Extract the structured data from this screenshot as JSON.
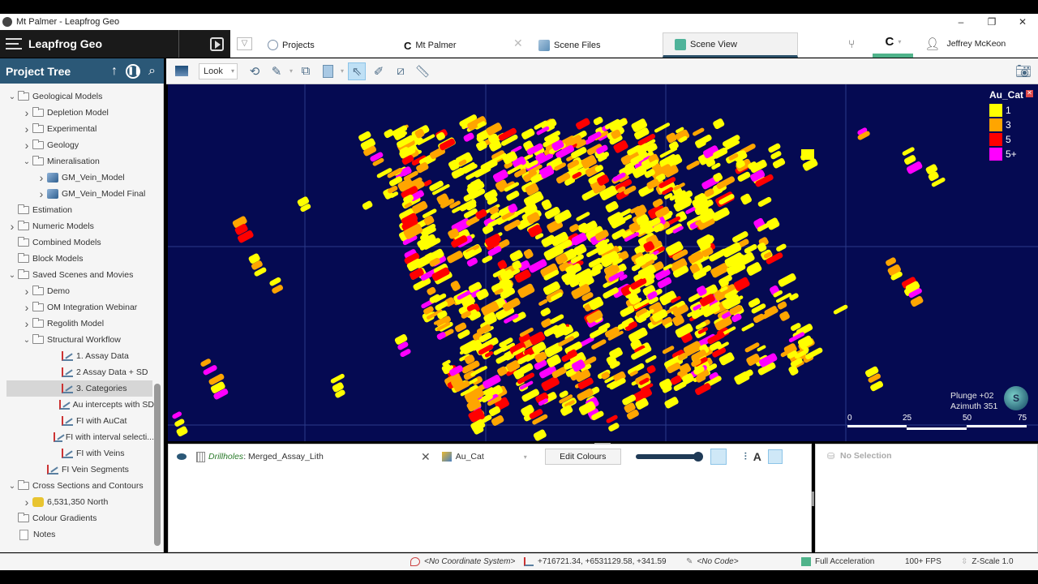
{
  "window": {
    "title": "Mt Palmer - Leapfrog Geo",
    "controls": [
      "–",
      "❐",
      "✕"
    ]
  },
  "appbar": {
    "brand": "Leapfrog Geo",
    "tabs": [
      {
        "label": "Projects",
        "icon": "projects-icon"
      },
      {
        "label": "Mt Palmer",
        "icon": "project-logo-icon"
      },
      {
        "label": "Scene Files",
        "icon": "scene-files-icon"
      },
      {
        "label": "Scene View",
        "icon": "scene-view-icon",
        "active": true
      }
    ],
    "user": "Jeffrey McKeon"
  },
  "project_tree": {
    "title": "Project Tree",
    "items": [
      {
        "label": "Geological Models",
        "level": 0,
        "expand": "open",
        "icon": "folder"
      },
      {
        "label": "Depletion Model",
        "level": 1,
        "expand": "closed",
        "icon": "folder"
      },
      {
        "label": "Experimental",
        "level": 1,
        "expand": "closed",
        "icon": "folder"
      },
      {
        "label": "Geology",
        "level": 1,
        "expand": "closed",
        "icon": "folder"
      },
      {
        "label": "Mineralisation",
        "level": 1,
        "expand": "open",
        "icon": "folder"
      },
      {
        "label": "GM_Vein_Model",
        "level": 2,
        "expand": "closed",
        "icon": "model"
      },
      {
        "label": "GM_Vein_Model Final",
        "level": 2,
        "expand": "closed",
        "icon": "model"
      },
      {
        "label": "Estimation",
        "level": 0,
        "expand": "none",
        "icon": "folder"
      },
      {
        "label": "Numeric Models",
        "level": 0,
        "expand": "closed",
        "icon": "folder"
      },
      {
        "label": "Combined Models",
        "level": 0,
        "expand": "none",
        "icon": "folder"
      },
      {
        "label": "Block Models",
        "level": 0,
        "expand": "none",
        "icon": "folder"
      },
      {
        "label": "Saved Scenes and Movies",
        "level": 0,
        "expand": "open",
        "icon": "folder"
      },
      {
        "label": "Demo",
        "level": 1,
        "expand": "closed",
        "icon": "folder"
      },
      {
        "label": "OM Integration Webinar",
        "level": 1,
        "expand": "closed",
        "icon": "folder"
      },
      {
        "label": "Regolith Model",
        "level": 1,
        "expand": "closed",
        "icon": "folder"
      },
      {
        "label": "Structural Workflow",
        "level": 1,
        "expand": "open",
        "icon": "folder"
      },
      {
        "label": "1. Assay Data",
        "level": 2,
        "expand": "none",
        "icon": "scene"
      },
      {
        "label": "2 Assay Data + SD",
        "level": 2,
        "expand": "none",
        "icon": "scene"
      },
      {
        "label": "3. Categories",
        "level": 2,
        "expand": "none",
        "icon": "scene",
        "selected": true
      },
      {
        "label": "Au intercepts with SD",
        "level": 2,
        "expand": "none",
        "icon": "scene"
      },
      {
        "label": "FI with AuCat",
        "level": 2,
        "expand": "none",
        "icon": "scene"
      },
      {
        "label": "FI with interval selecti...",
        "level": 2,
        "expand": "none",
        "icon": "scene"
      },
      {
        "label": "FI with Veins",
        "level": 2,
        "expand": "none",
        "icon": "scene"
      },
      {
        "label": "FI Vein Segments",
        "level": 1,
        "expand": "none",
        "icon": "scene"
      },
      {
        "label": "Cross Sections and Contours",
        "level": 0,
        "expand": "open",
        "icon": "folder"
      },
      {
        "label": "6,531,350 North",
        "level": 1,
        "expand": "closed",
        "icon": "section"
      },
      {
        "label": "Colour Gradients",
        "level": 0,
        "expand": "none",
        "icon": "folder"
      },
      {
        "label": "Notes",
        "level": 0,
        "expand": "none",
        "icon": "notes"
      }
    ]
  },
  "toolbar": {
    "look_label": "Look"
  },
  "scene": {
    "legend": {
      "title": "Au_Cat",
      "entries": [
        {
          "label": "1",
          "color": "#ffff00"
        },
        {
          "label": "3",
          "color": "#ffa500"
        },
        {
          "label": "5",
          "color": "#ff0000"
        },
        {
          "label": "5+",
          "color": "#ff00ff"
        }
      ]
    },
    "plunge": "Plunge +02",
    "azimuth": "Azimuth 351",
    "globe_label": "S",
    "scale_ticks": [
      "0",
      "25",
      "50",
      "75"
    ],
    "background": "#050a52"
  },
  "shape_list": {
    "object_type": "Drillholes",
    "object_name": ": Merged_Assay_Lith",
    "colour_by": "Au_Cat",
    "edit_colours": "Edit Colours",
    "opacity": 1.0
  },
  "selection_panel": {
    "label": "No Selection"
  },
  "statusbar": {
    "coord_system": "<No Coordinate System>",
    "coordinates": "+716721.34, +6531129.58, +341.59",
    "code": "<No Code>",
    "acceleration": "Full Acceleration",
    "fps": "100+ FPS",
    "zscale": "Z-Scale 1.0"
  }
}
